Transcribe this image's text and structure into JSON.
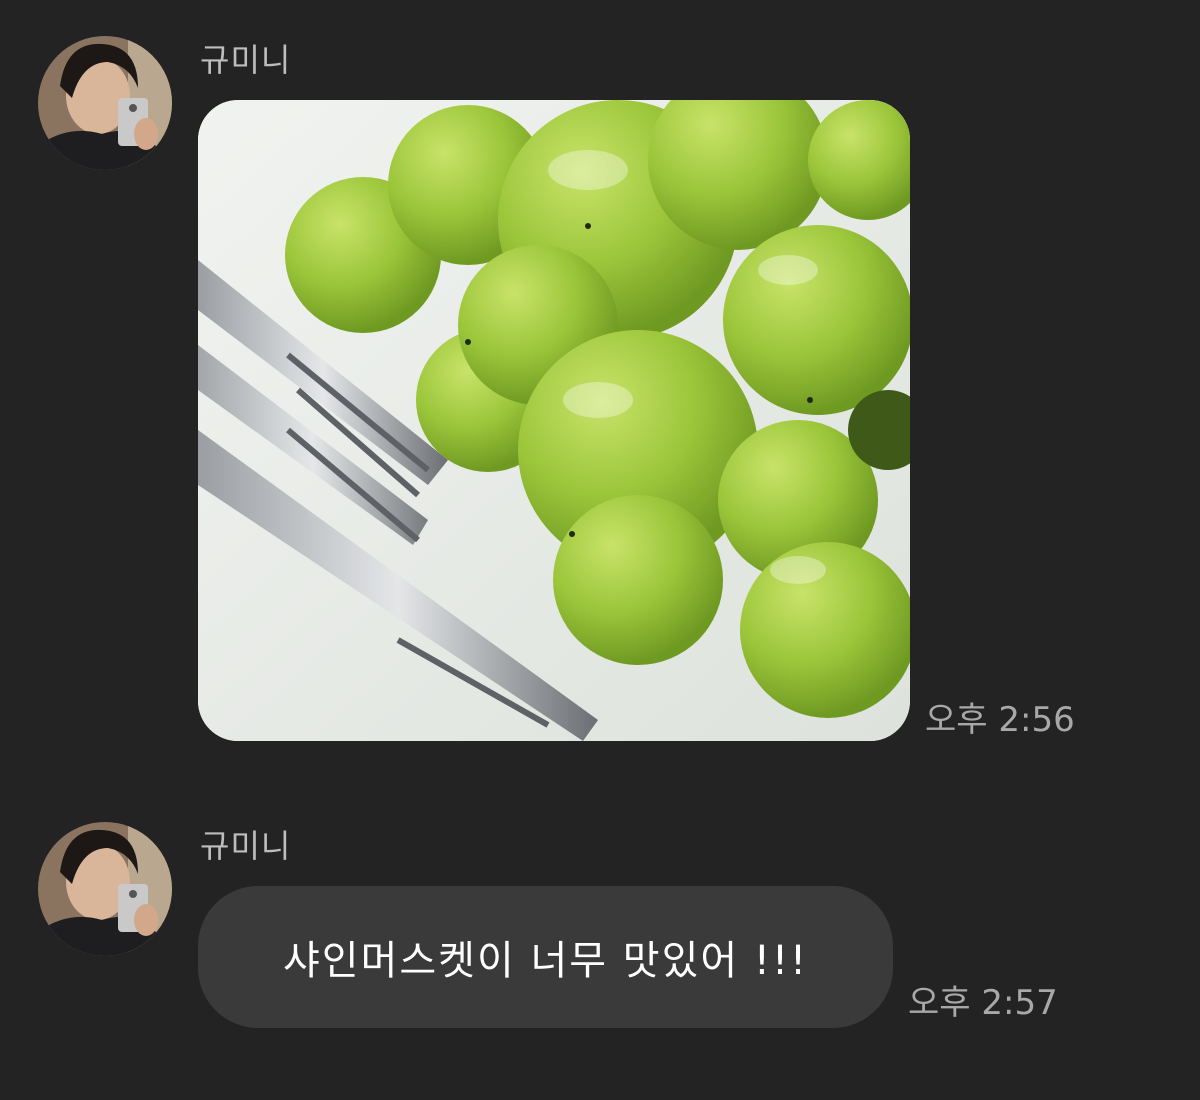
{
  "messages": [
    {
      "sender": "규미니",
      "type": "photo",
      "time": "오후 2:56"
    },
    {
      "sender": "규미니",
      "type": "text",
      "text": "샤인머스켓이 너무 맛있어 !!!",
      "time": "오후 2:57"
    }
  ],
  "colors": {
    "background": "#232323",
    "bubble": "#3a3a3a",
    "text": "#ffffff",
    "meta": "#a8a8a8",
    "grape": "#9cc63a"
  }
}
